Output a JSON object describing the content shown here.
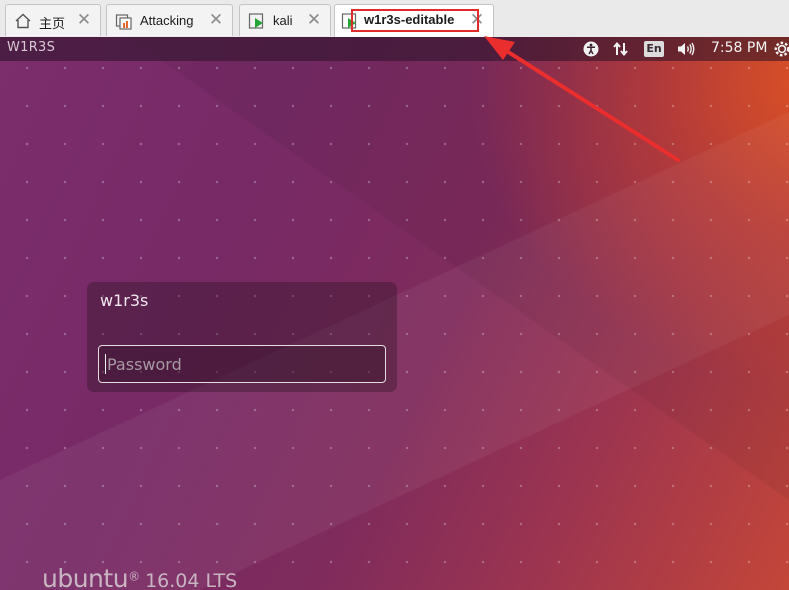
{
  "tabs": [
    {
      "label": "主页",
      "icon": "home-icon",
      "active": false
    },
    {
      "label": "Attacking",
      "icon": "vm-folder-icon",
      "active": false
    },
    {
      "label": "kali",
      "icon": "vm-running-icon",
      "active": false
    },
    {
      "label": "w1r3s-editable",
      "icon": "vm-running-icon",
      "active": true
    }
  ],
  "close_glyph": "✕",
  "annotation_color": "#e02b2b",
  "guest": {
    "hostname": "W1R3S",
    "indicators": [
      "accessibility-icon",
      "network-icon",
      "keyboard-layout-indicator",
      "volume-icon",
      "gear-icon"
    ],
    "keyboard_layout": "En",
    "clock": "7:58 PM",
    "login": {
      "username": "w1r3s",
      "password_placeholder": "Password"
    },
    "branding": {
      "word": "ubuntu",
      "mark": "®",
      "version": "16.04 LTS"
    }
  }
}
